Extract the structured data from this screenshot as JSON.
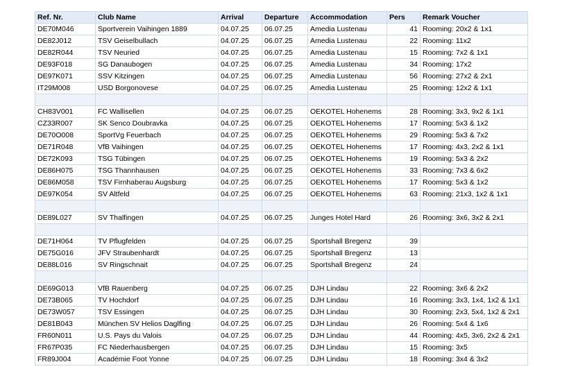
{
  "columns": [
    "Ref. Nr.",
    "Club Name",
    "Arrival",
    "Departure",
    "Accommodation",
    "Pers",
    "Remark Voucher"
  ],
  "rows": [
    [
      "DE70M046",
      "Sportverein Vaihingen 1889",
      "04.07.25",
      "06.07.25",
      "Amedia Lustenau",
      "41",
      "Rooming: 20x2 & 1x1"
    ],
    [
      "DE82J012",
      "TSV Geiselbullach",
      "04.07.25",
      "06.07.25",
      "Amedia Lustenau",
      "22",
      "Rooming: 11x2"
    ],
    [
      "DE82R044",
      "TSV Neuried",
      "04.07.25",
      "06.07.25",
      "Amedia Lustenau",
      "15",
      "Rooming: 7x2 & 1x1"
    ],
    [
      "DE93F018",
      "SG Danaubogen",
      "04.07.25",
      "06.07.25",
      "Amedia Lustenau",
      "34",
      "Rooming: 17x2"
    ],
    [
      "DE97K071",
      "SSV Kitzingen",
      "04.07.25",
      "06.07.25",
      "Amedia Lustenau",
      "56",
      "Rooming: 27x2 & 2x1"
    ],
    [
      "IT29M008",
      "USD Borgonovese",
      "04.07.25",
      "06.07.25",
      "Amedia Lustenau",
      "25",
      "Rooming: 12x2 & 1x1"
    ],
    [
      "",
      "",
      "",
      "",
      "",
      "",
      ""
    ],
    [
      "CH83V001",
      "FC Wallisellen",
      "04.07.25",
      "06.07.25",
      "OEKOTEL Hohenems",
      "28",
      "Rooming: 3x3, 9x2 & 1x1"
    ],
    [
      "CZ33R007",
      "SK Senco Doubravka",
      "04.07.25",
      "06.07.25",
      "OEKOTEL Hohenems",
      "17",
      "Rooming: 5x3 & 1x2"
    ],
    [
      "DE70O008",
      "SportVg Feuerbach",
      "04.07.25",
      "06.07.25",
      "OEKOTEL Hohenems",
      "29",
      "Rooming: 5x3 & 7x2"
    ],
    [
      "DE71R048",
      "VfB Vaihingen",
      "04.07.25",
      "06.07.25",
      "OEKOTEL Hohenems",
      "17",
      "Rooming: 4x3, 2x2 & 1x1"
    ],
    [
      "DE72K093",
      "TSG Tübingen",
      "04.07.25",
      "06.07.25",
      "OEKOTEL Hohenems",
      "19",
      "Rooming: 5x3 & 2x2"
    ],
    [
      "DE86H075",
      "TSG Thannhausen",
      "04.07.25",
      "06.07.25",
      "OEKOTEL Hohenems",
      "33",
      "Rooming: 7x3 & 6x2"
    ],
    [
      "DE86M058",
      "TSV Firnhaberau Augsburg",
      "04.07.25",
      "06.07.25",
      "OEKOTEL Hohenems",
      "17",
      "Rooming: 5x3 & 1x2"
    ],
    [
      "DE97K054",
      "SV Altfeld",
      "04.07.25",
      "06.07.25",
      "OEKOTEL Hohenems",
      "63",
      "Rooming: 21x3, 1x2 & 1x1"
    ],
    [
      "",
      "",
      "",
      "",
      "",
      "",
      ""
    ],
    [
      "DE89L027",
      "SV Thalfingen",
      "04.07.25",
      "06.07.25",
      "Junges Hotel Hard",
      "26",
      "Rooming: 3x6, 3x2 & 2x1"
    ],
    [
      "",
      "",
      "",
      "",
      "",
      "",
      ""
    ],
    [
      "DE71H064",
      "TV Pflugfelden",
      "04.07.25",
      "06.07.25",
      "Sportshall Bregenz",
      "39",
      ""
    ],
    [
      "DE75G016",
      "JFV Straubenhardt",
      "04.07.25",
      "06.07.25",
      "Sportshall Bregenz",
      "13",
      ""
    ],
    [
      "DE88L016",
      "SV Ringschnait",
      "04.07.25",
      "06.07.25",
      "Sportshall Bregenz",
      "24",
      ""
    ],
    [
      "",
      "",
      "",
      "",
      "",
      "",
      ""
    ],
    [
      "DE69G013",
      "VfB Rauenberg",
      "04.07.25",
      "06.07.25",
      "DJH Lindau",
      "22",
      "Rooming: 3x6 & 2x2"
    ],
    [
      "DE73B065",
      "TV  Hochdorf",
      "04.07.25",
      "06.07.25",
      "DJH Lindau",
      "16",
      "Rooming: 3x3, 1x4, 1x2 & 1x1"
    ],
    [
      "DE73W057",
      "TSV Essingen",
      "04.07.25",
      "06.07.25",
      "DJH Lindau",
      "30",
      "Rooming: 2x3, 5x4, 1x2 & 2x1"
    ],
    [
      "DE81B043",
      "München SV Helios Daglfing",
      "04.07.25",
      "06.07.25",
      "DJH Lindau",
      "26",
      "Rooming: 5x4 & 1x6"
    ],
    [
      "FR60N011",
      "U.S. Pays du Valois",
      "04.07.25",
      "06.07.25",
      "DJH Lindau",
      "44",
      "Rooming: 4x5, 3x6, 2x2 & 2x1"
    ],
    [
      "FR67P035",
      "FC Niederhausbergen",
      "04.07.25",
      "06.07.25",
      "DJH Lindau",
      "15",
      "Rooming: 3x5"
    ],
    [
      "FR89J004",
      "Académie Foot Yonne",
      "04.07.25",
      "06.07.25",
      "DJH Lindau",
      "18",
      "Rooming: 3x4 & 3x2"
    ]
  ]
}
